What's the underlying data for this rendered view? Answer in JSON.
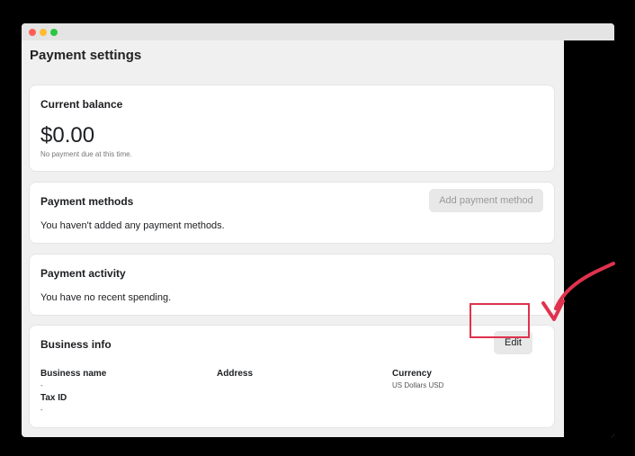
{
  "header": {
    "title": "Payment settings"
  },
  "balance": {
    "title": "Current balance",
    "amount": "$0.00",
    "note": "No payment due at this time."
  },
  "methods": {
    "title": "Payment methods",
    "add_label": "Add payment method",
    "empty": "You haven't added any payment methods."
  },
  "activity": {
    "title": "Payment activity",
    "empty": "You have no recent spending."
  },
  "business": {
    "title": "Business info",
    "edit_label": "Edit",
    "name_label": "Business name",
    "name_value": "-",
    "address_label": "Address",
    "currency_label": "Currency",
    "currency_value": "US Dollars USD",
    "tax_label": "Tax ID",
    "tax_value": "-"
  },
  "annotation": {
    "highlight_color": "#e0324d"
  }
}
